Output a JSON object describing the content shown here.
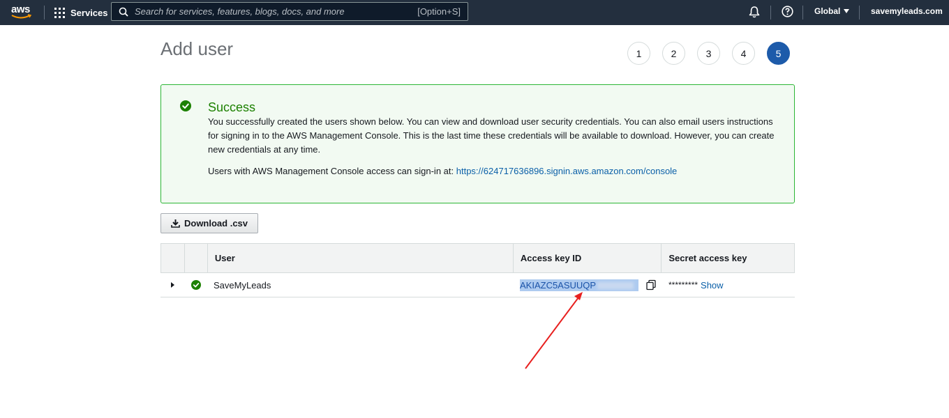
{
  "nav": {
    "logo_text": "aws",
    "services_label": "Services",
    "search_placeholder": "Search for services, features, blogs, docs, and more",
    "search_shortcut": "[Option+S]",
    "region_label": "Global",
    "account_label": "savemyleads.com",
    "icons": [
      "grid-icon",
      "search-icon",
      "bell-icon",
      "help-icon"
    ]
  },
  "header": {
    "title": "Add user",
    "steps": [
      "1",
      "2",
      "3",
      "4",
      "5"
    ],
    "active_step": "5"
  },
  "alert": {
    "title": "Success",
    "body": "You successfully created the users shown below. You can view and download user security credentials. You can also email users instructions for signing in to the AWS Management Console. This is the last time these credentials will be available to download. However, you can create new credentials at any time.",
    "signin_text": "Users with AWS Management Console access can sign-in at:",
    "signin_url": "https://624717636896.signin.aws.amazon.com/console",
    "color": "#1d8102"
  },
  "download_button": {
    "label": "Download .csv"
  },
  "table": {
    "columns": [
      "User",
      "Access key ID",
      "Secret access key"
    ],
    "rows": [
      {
        "user": "SaveMyLeads",
        "access_key_id": "AKIAZC5ASUUQP",
        "secret_mask": "*********",
        "show_label": "Show"
      }
    ]
  },
  "colors": {
    "nav_bg": "#232f3e",
    "accent": "#1d5baa",
    "success": "#1d8102",
    "link": "#0a5fa8",
    "annotation": "#e8201f"
  }
}
